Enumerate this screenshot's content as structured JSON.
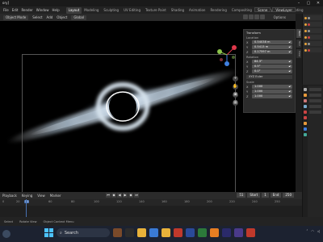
{
  "titlebar": {
    "title": "ory]",
    "minimize": "–",
    "maximize": "▢",
    "close": "✕"
  },
  "menu": [
    "File",
    "Edit",
    "Render",
    "Window",
    "Help"
  ],
  "workspace_tabs": [
    {
      "label": "Layout",
      "active": true
    },
    {
      "label": "Modeling",
      "active": false
    },
    {
      "label": "Sculpting",
      "active": false
    },
    {
      "label": "UV Editing",
      "active": false
    },
    {
      "label": "Texture Paint",
      "active": false
    },
    {
      "label": "Shading",
      "active": false
    },
    {
      "label": "Animation",
      "active": false
    },
    {
      "label": "Rendering",
      "active": false
    },
    {
      "label": "Compositing",
      "active": false
    },
    {
      "label": "Geometry Nodes",
      "active": false
    },
    {
      "label": "Scripting",
      "active": false
    }
  ],
  "scene": {
    "name": "Scene",
    "view_layer": "ViewLayer"
  },
  "viewport_header": {
    "mode": "Object Mode",
    "items": [
      "Select",
      "Add",
      "Object"
    ],
    "transform_orientation": "Global",
    "options": "Options"
  },
  "npanel": {
    "header": "Transform",
    "location_label": "Location",
    "location": [
      {
        "axis": "X",
        "value": "0.54038 m"
      },
      {
        "axis": "Y",
        "value": "0.5413 m"
      },
      {
        "axis": "Z",
        "value": "0.17597 m"
      }
    ],
    "rotation_label": "Rotation",
    "rotation": [
      {
        "axis": "X",
        "value": "84.3°"
      },
      {
        "axis": "Y",
        "value": "0.5°"
      },
      {
        "axis": "Z",
        "value": "0.0°"
      }
    ],
    "rotation_mode": "XYZ Euler",
    "scale_label": "Scale",
    "scale": [
      {
        "axis": "X",
        "value": "1.000"
      },
      {
        "axis": "Y",
        "value": "1.000"
      },
      {
        "axis": "Z",
        "value": "1.000"
      }
    ]
  },
  "side_tabs": [
    "Item",
    "Tool",
    "View"
  ],
  "timeline": {
    "playback": "Playback",
    "keying": "Keying",
    "view": "View",
    "marker": "Marker",
    "current_frame": "51",
    "start_label": "Start",
    "start": "1",
    "end_label": "End",
    "end": "250",
    "ticks": [
      "0",
      "20",
      "51",
      "60",
      "80",
      "100",
      "120",
      "140",
      "160",
      "180",
      "200",
      "220",
      "240",
      "250"
    ]
  },
  "status": {
    "select": "Select",
    "rotate": "Rotate View",
    "context": "Object Context Menu"
  },
  "taskbar": {
    "search_placeholder": "Search"
  },
  "colors": {
    "accent": "#4772b3",
    "gizmo_x": "#e0384b",
    "gizmo_y": "#8bc34a",
    "gizmo_z": "#3f7fe0",
    "disk": "#c6d6e4"
  }
}
